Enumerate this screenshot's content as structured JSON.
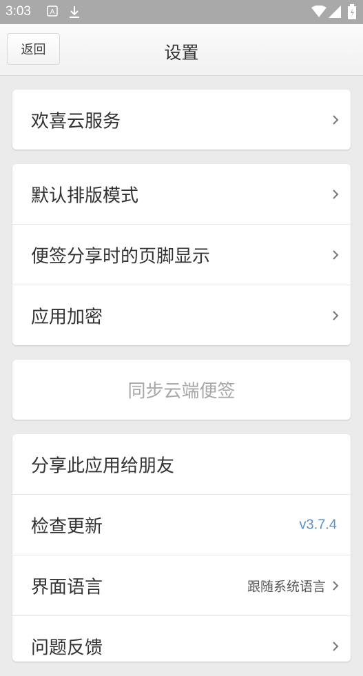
{
  "status_bar": {
    "time": "3:03",
    "icons": [
      "notification-a-icon",
      "download-icon",
      "wifi-icon",
      "signal-icon",
      "battery-icon"
    ]
  },
  "header": {
    "back_label": "返回",
    "title": "设置"
  },
  "sections": {
    "cloud": {
      "label": "欢喜云服务"
    },
    "layout_mode": {
      "label": "默认排版模式"
    },
    "footer_display": {
      "label": "便签分享时的页脚显示"
    },
    "app_lock": {
      "label": "应用加密"
    },
    "sync": {
      "label": "同步云端便签"
    },
    "share_app": {
      "label": "分享此应用给朋友"
    },
    "check_update": {
      "label": "检查更新",
      "version": "v3.7.4"
    },
    "language": {
      "label": "界面语言",
      "value": "跟随系统语言"
    },
    "feedback": {
      "label": "问题反馈"
    }
  },
  "colors": {
    "status_bar": "#a9a9a9",
    "background": "#ebebeb",
    "version_text": "#5b8ec2"
  }
}
